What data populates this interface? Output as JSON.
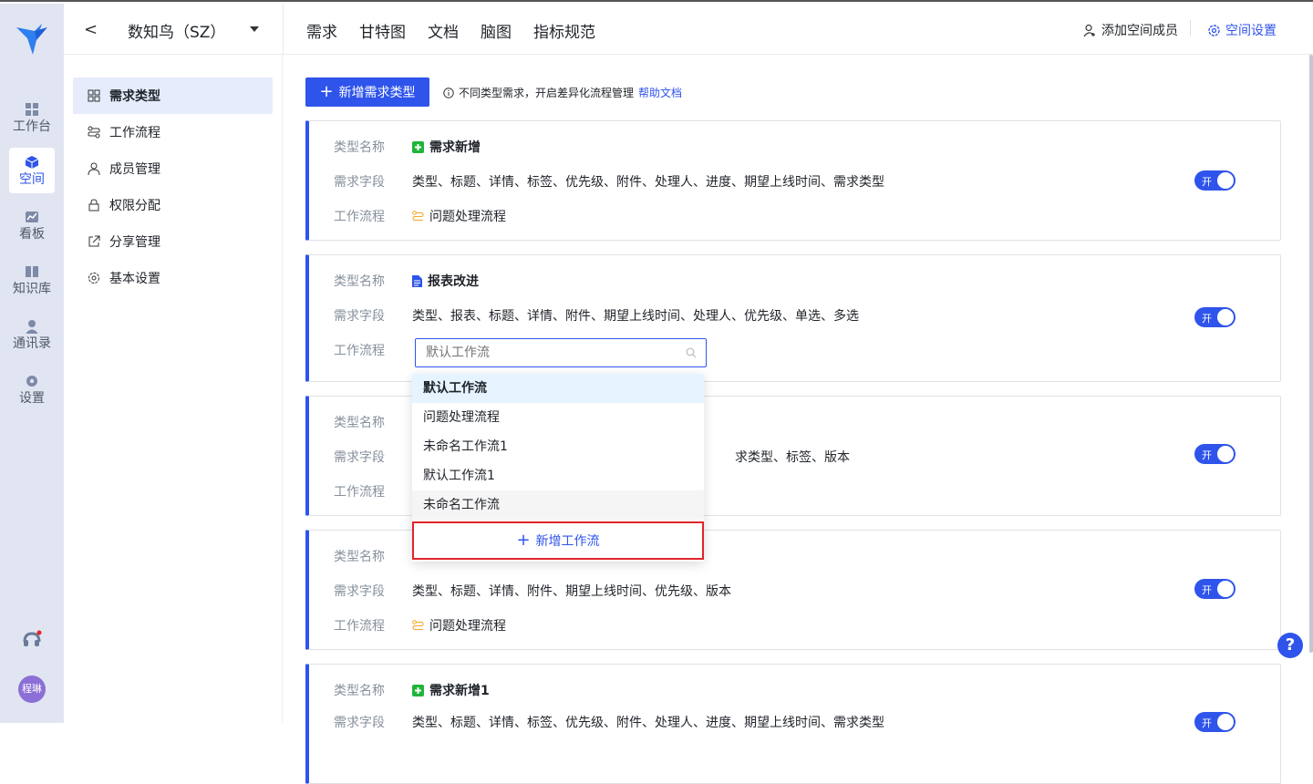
{
  "rail": {
    "items": [
      {
        "label": "工作台",
        "icon": "dashboard-icon"
      },
      {
        "label": "空间",
        "icon": "cube-icon"
      },
      {
        "label": "看板",
        "icon": "chart-icon"
      },
      {
        "label": "知识库",
        "icon": "book-icon"
      },
      {
        "label": "通讯录",
        "icon": "user-icon"
      },
      {
        "label": "设置",
        "icon": "gear-icon"
      }
    ],
    "avatar": "程琳"
  },
  "topbar": {
    "back": "<",
    "project": "数知鸟（SZ）",
    "tabs": [
      "需求",
      "甘特图",
      "文档",
      "脑图",
      "指标规范"
    ],
    "add_member": "添加空间成员",
    "space_settings": "空间设置"
  },
  "sidebar": {
    "items": [
      "需求类型",
      "工作流程",
      "成员管理",
      "权限分配",
      "分享管理",
      "基本设置"
    ]
  },
  "main": {
    "add_button": "新增需求类型",
    "tip": "不同类型需求，开启差异化流程管理",
    "help_link": "帮助文档",
    "labels": {
      "name": "类型名称",
      "fields": "需求字段",
      "flow": "工作流程"
    },
    "switch_label": "开",
    "cards": [
      {
        "name": "需求新增",
        "fields": "类型、标题、详情、标签、优先级、附件、处理人、进度、期望上线时间、需求类型",
        "flow": "问题处理流程"
      },
      {
        "name": "报表改进",
        "fields": "类型、报表、标题、详情、附件、期望上线时间、处理人、优先级、单选、多选",
        "flow_placeholder": "默认工作流"
      },
      {
        "name": "",
        "fields": "求类型、标签、版本",
        "flow": ""
      },
      {
        "name": "",
        "fields": "类型、标题、详情、附件、期望上线时间、优先级、版本",
        "flow": "问题处理流程"
      },
      {
        "name": "需求新增1",
        "fields": "类型、标题、详情、标签、优先级、附件、处理人、进度、期望上线时间、需求类型"
      }
    ]
  },
  "dropdown": {
    "options": [
      "默认工作流",
      "问题处理流程",
      "未命名工作流1",
      "默认工作流1",
      "未命名工作流"
    ],
    "add": "新增工作流"
  },
  "colors": {
    "accent": "#2f54eb",
    "highlight": "#e0242a"
  }
}
